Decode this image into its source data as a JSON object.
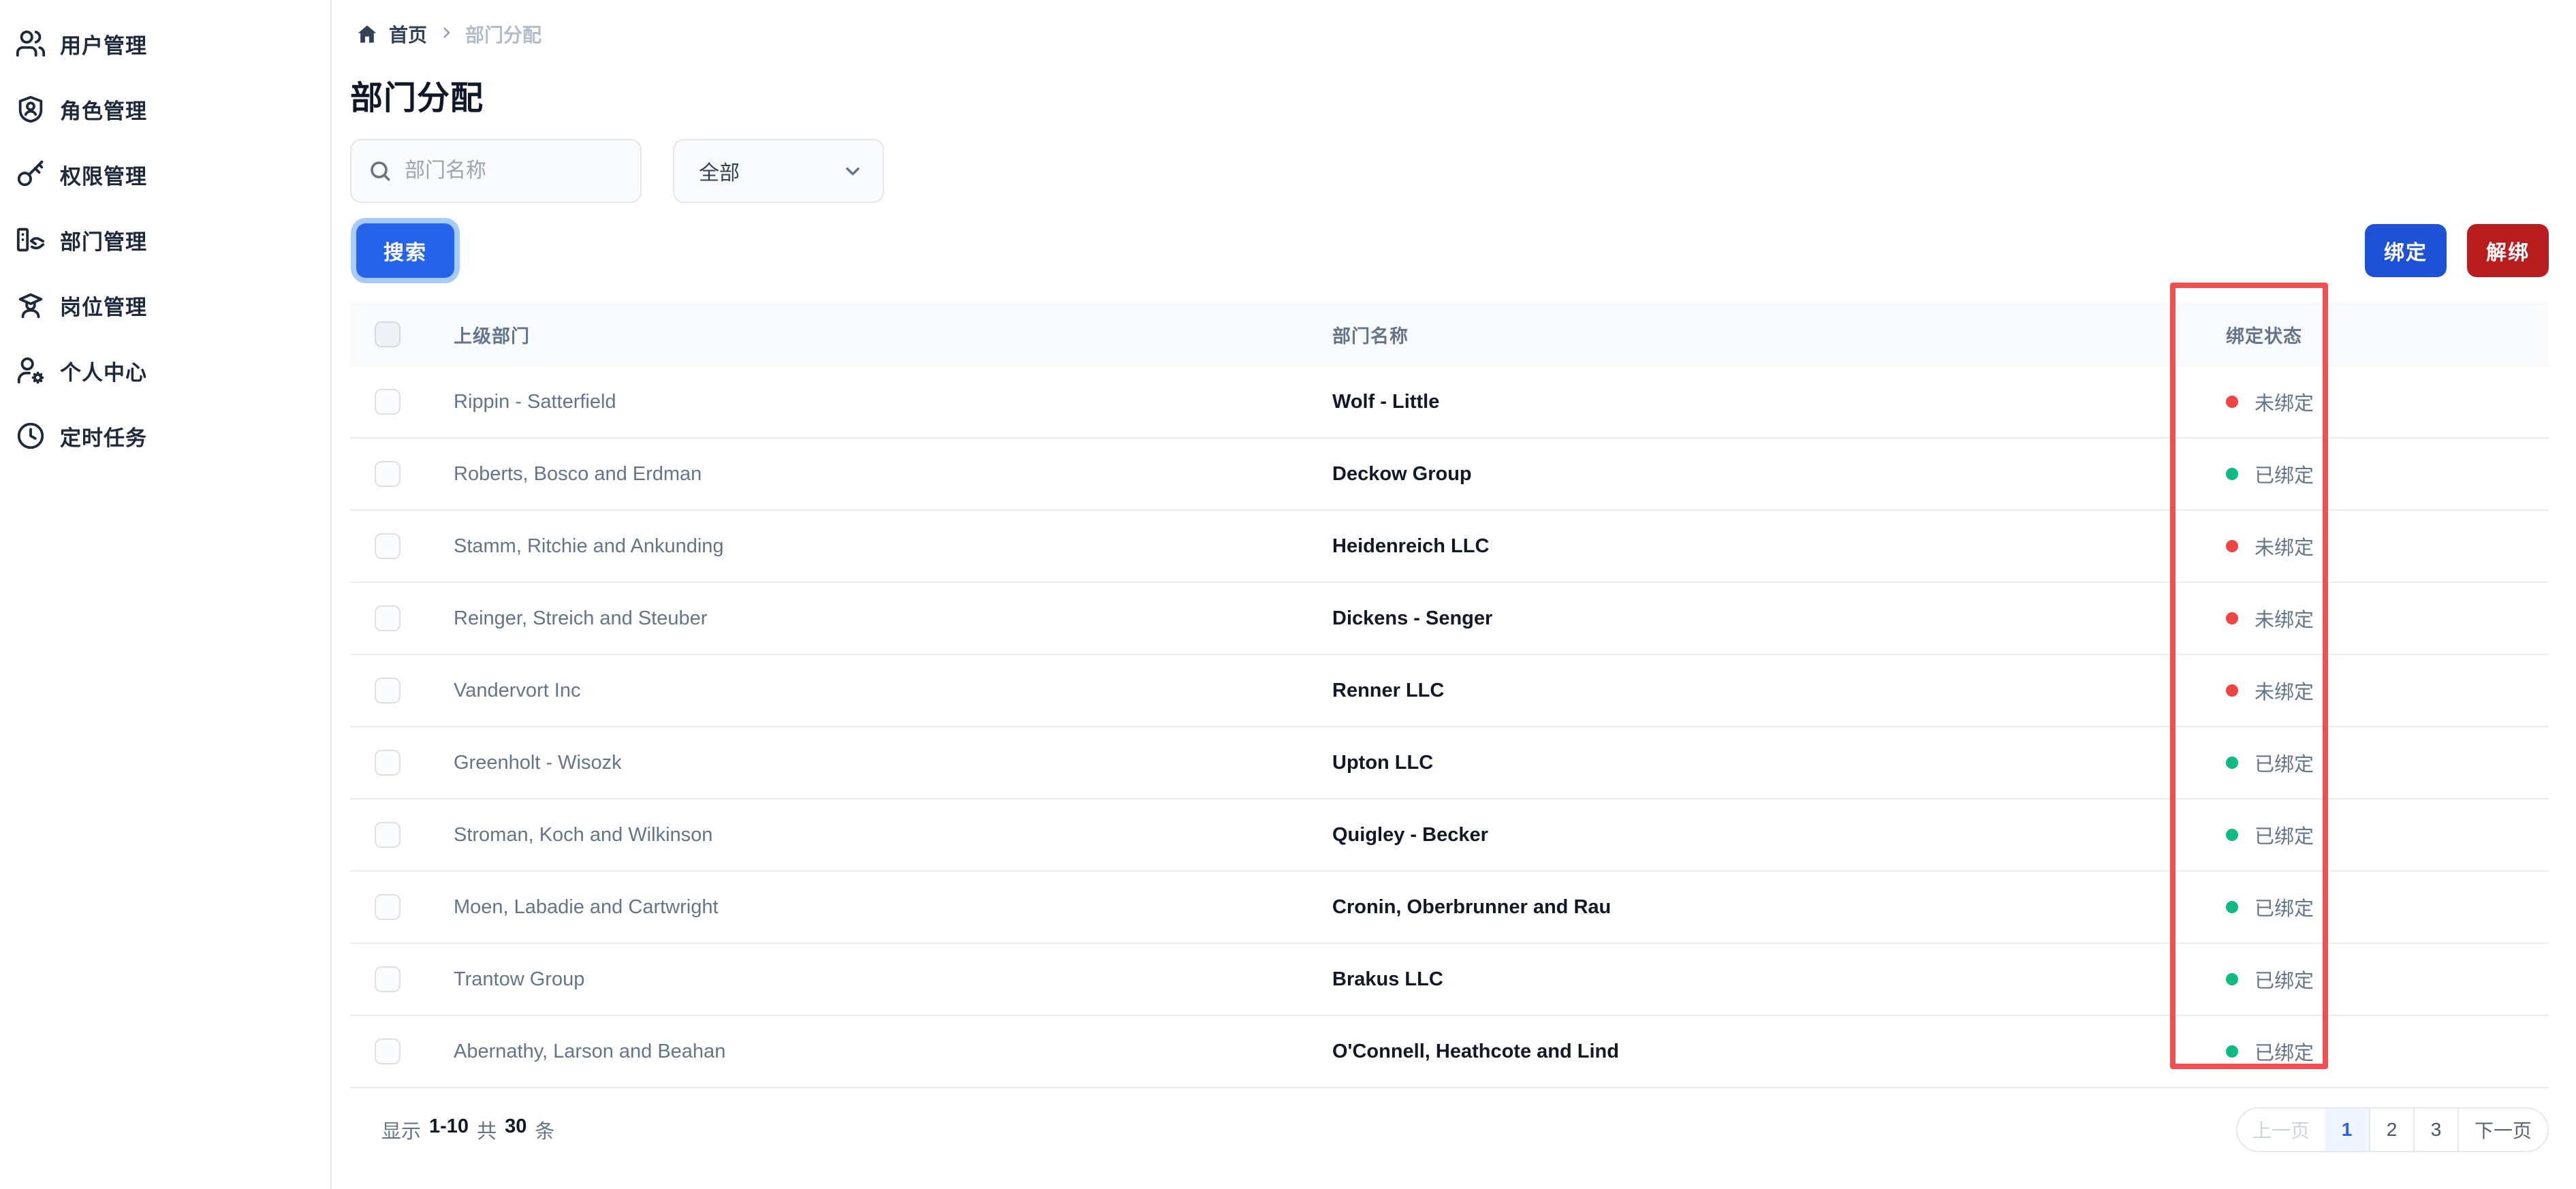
{
  "sidebar": {
    "items": [
      {
        "label": "用户管理",
        "icon": "users-icon"
      },
      {
        "label": "角色管理",
        "icon": "shield-user-icon"
      },
      {
        "label": "权限管理",
        "icon": "key-icon"
      },
      {
        "label": "部门管理",
        "icon": "department-icon"
      },
      {
        "label": "岗位管理",
        "icon": "position-icon"
      },
      {
        "label": "个人中心",
        "icon": "user-gear-icon"
      },
      {
        "label": "定时任务",
        "icon": "clock-icon"
      }
    ]
  },
  "breadcrumb": {
    "home": "首页",
    "current": "部门分配"
  },
  "page": {
    "title": "部门分配"
  },
  "filters": {
    "search_placeholder": "部门名称",
    "select_value": "全部",
    "search_button": "搜索"
  },
  "actions": {
    "bind": "绑定",
    "unbind": "解绑"
  },
  "table": {
    "headers": {
      "parent": "上级部门",
      "name": "部门名称",
      "status": "绑定状态"
    },
    "rows": [
      {
        "parent": "Rippin - Satterfield",
        "name": "Wolf - Little",
        "bound": false
      },
      {
        "parent": "Roberts, Bosco and Erdman",
        "name": "Deckow Group",
        "bound": true
      },
      {
        "parent": "Stamm, Ritchie and Ankunding",
        "name": "Heidenreich LLC",
        "bound": false
      },
      {
        "parent": "Reinger, Streich and Steuber",
        "name": "Dickens - Senger",
        "bound": false
      },
      {
        "parent": "Vandervort Inc",
        "name": "Renner LLC",
        "bound": false
      },
      {
        "parent": "Greenholt - Wisozk",
        "name": "Upton LLC",
        "bound": true
      },
      {
        "parent": "Stroman, Koch and Wilkinson",
        "name": "Quigley - Becker",
        "bound": true
      },
      {
        "parent": "Moen, Labadie and Cartwright",
        "name": "Cronin, Oberbrunner and Rau",
        "bound": true
      },
      {
        "parent": "Trantow Group",
        "name": "Brakus LLC",
        "bound": true
      },
      {
        "parent": "Abernathy, Larson and Beahan",
        "name": "O'Connell, Heathcote and Lind",
        "bound": true
      }
    ]
  },
  "status_labels": {
    "bound": "已绑定",
    "unbound": "未绑定"
  },
  "colors": {
    "bound_dot": "#10b981",
    "unbound_dot": "#ef4444",
    "accent_blue": "#2563eb",
    "bind_blue": "#1d52d6",
    "danger_red": "#b91c1c",
    "highlight_red": "#f25050"
  },
  "pagination": {
    "summary_prefix": "显示",
    "range": "1-10",
    "total_word": "共",
    "total": "30",
    "unit": "条",
    "prev": "上一页",
    "pages": [
      "1",
      "2",
      "3"
    ],
    "active_page": "1",
    "next": "下一页"
  }
}
